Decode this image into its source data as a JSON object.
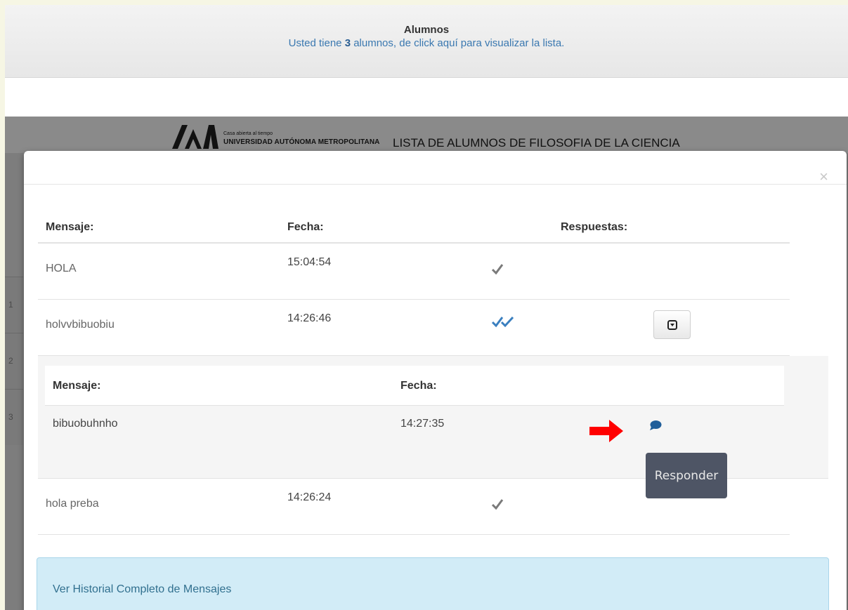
{
  "alumnos": {
    "title": "Alumnos",
    "text_before": "Usted tiene ",
    "count": "3",
    "text_after": " alumnos, de click aquí para visualizar la lista."
  },
  "background": {
    "logo_small": "Casa abierta al tiempo",
    "logo_name": "UNIVERSIDAD AUTÓNOMA METROPOLITANA",
    "list_title": "LISTA DE ALUMNOS DE FILOSOFIA DE LA CIENCIA",
    "row_numbers": [
      "1",
      "2",
      "3"
    ]
  },
  "modal": {
    "close_label": "×",
    "headers": {
      "mensaje": "Mensaje:",
      "fecha": "Fecha:",
      "respuestas": "Respuestas:"
    },
    "messages": [
      {
        "text": "HOLA",
        "time": "15:04:54",
        "status": "check-single"
      },
      {
        "text": "holvvbibuobiu",
        "time": "14:26:46",
        "status": "check-double"
      },
      {
        "text": "hola preba",
        "time": "14:26:24",
        "status": "check-single"
      }
    ],
    "reply_table": {
      "headers": {
        "mensaje": "Mensaje:",
        "fecha": "Fecha:"
      },
      "rows": [
        {
          "text": "bibuobuhnho",
          "time": "14:27:35"
        }
      ]
    },
    "tooltip": "Responder",
    "history_link": "Ver Historial Completo de Mensajes"
  },
  "colors": {
    "link": "#3a78b0",
    "tooltip_bg": "#4e5565",
    "alert_bg": "#d2ecf7",
    "double_check": "#3a7fbf",
    "arrow": "#ff0000"
  }
}
